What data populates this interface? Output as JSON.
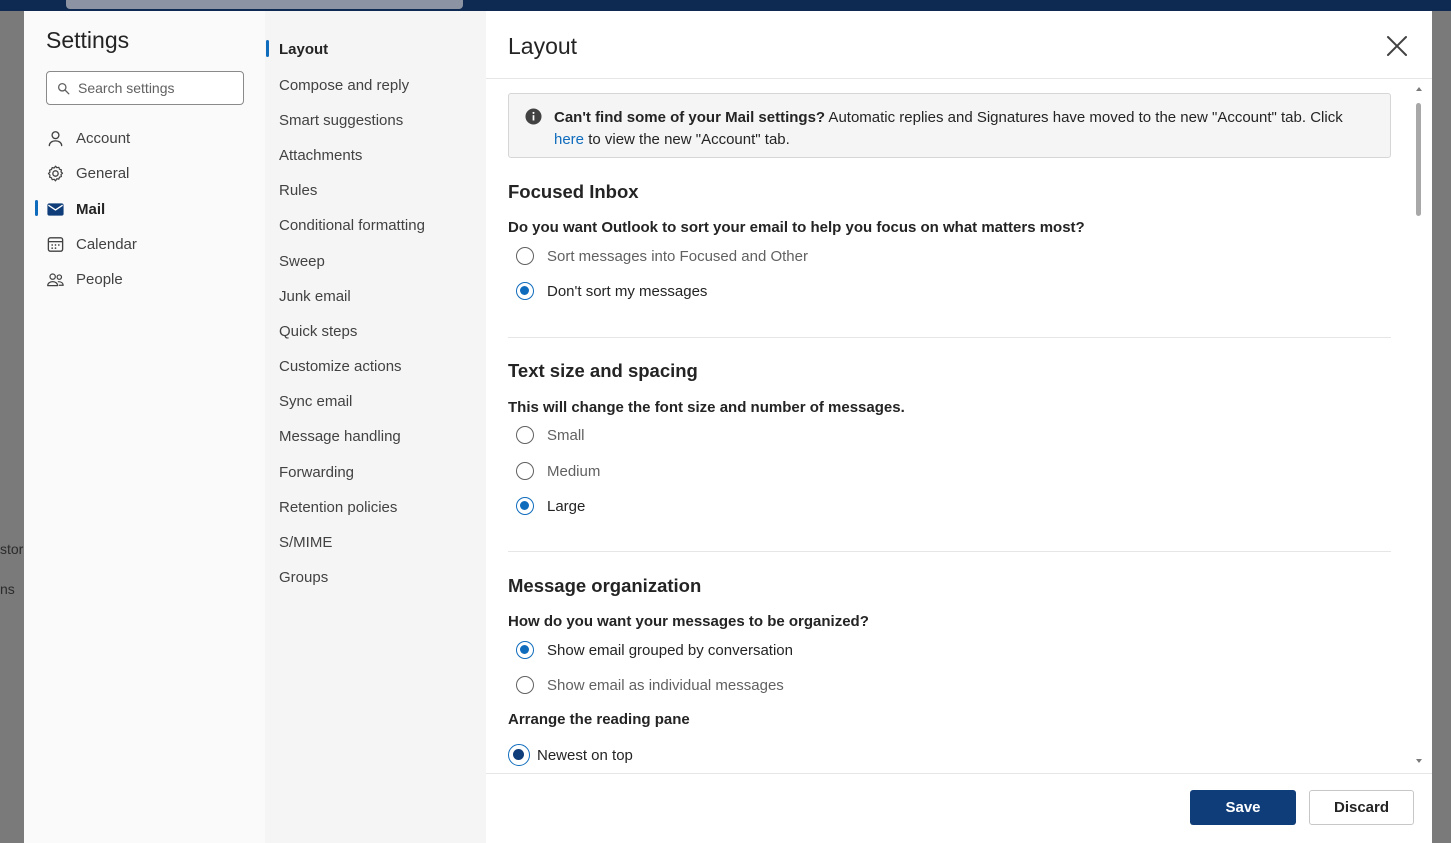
{
  "background": {
    "left_fragments": [
      "stor",
      "ns"
    ]
  },
  "nav": {
    "title": "Settings",
    "search_placeholder": "Search settings",
    "categories": [
      {
        "label": "Account",
        "icon": "person-icon"
      },
      {
        "label": "General",
        "icon": "gear-icon"
      },
      {
        "label": "Mail",
        "icon": "mail-icon",
        "active": true
      },
      {
        "label": "Calendar",
        "icon": "calendar-icon"
      },
      {
        "label": "People",
        "icon": "people-icon"
      }
    ],
    "subcategories": [
      "Layout",
      "Compose and reply",
      "Smart suggestions",
      "Attachments",
      "Rules",
      "Conditional formatting",
      "Sweep",
      "Junk email",
      "Quick steps",
      "Customize actions",
      "Sync email",
      "Message handling",
      "Forwarding",
      "Retention policies",
      "S/MIME",
      "Groups"
    ],
    "active_subcategory": "Layout"
  },
  "content": {
    "title": "Layout",
    "info": {
      "bold": "Can't find some of your Mail settings?",
      "text1": " Automatic replies and Signatures have moved to the new \"Account\" tab. Click ",
      "link": "here",
      "text2": " to view the new \"Account\" tab."
    },
    "focused_inbox": {
      "title": "Focused Inbox",
      "question": "Do you want Outlook to sort your email to help you focus on what matters most?",
      "options": [
        "Sort messages into Focused and Other",
        "Don't sort my messages"
      ],
      "selected": "Don't sort my messages"
    },
    "text_size": {
      "title": "Text size and spacing",
      "question": "This will change the font size and number of messages.",
      "options": [
        "Small",
        "Medium",
        "Large"
      ],
      "selected": "Large"
    },
    "message_org": {
      "title": "Message organization",
      "question": "How do you want your messages to be organized?",
      "options": [
        "Show email grouped by conversation",
        "Show email as individual messages"
      ],
      "selected": "Show email grouped by conversation",
      "reading_pane_label": "Arrange the reading pane",
      "reading_pane_options": [
        "Newest on top"
      ],
      "reading_pane_selected": "Newest on top"
    },
    "buttons": {
      "save": "Save",
      "discard": "Discard"
    }
  },
  "colors": {
    "accent": "#0f6cbd",
    "primary_button": "#0f3d7a"
  }
}
